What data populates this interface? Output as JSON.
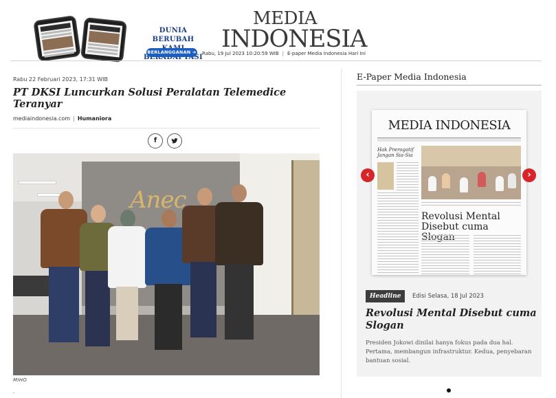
{
  "header": {
    "promo_line1": "DUNIA BERUBAH",
    "promo_line2": "KAMI BERADAPTASI",
    "subscribe_label": "BERLANGGANAN",
    "logo_line1": "MEDIA",
    "logo_line2": "INDONESIA",
    "date_time": "Rabu, 19 Jul 2023 10:20:59 WIB",
    "separator": "|",
    "epaper_link": "E-paper Media Indonesia Hari Ini"
  },
  "article": {
    "date": "Rabu 22 Februari 2023, 17:31 WIB",
    "title": "PT DKSI Luncurkan Solusi Peralatan Telemedice Teranyar",
    "source": "mediaindonesia.com",
    "source_separator": "|",
    "category": "Humaniora",
    "share_facebook": "f",
    "share_twitter": "🐦",
    "photo_sign": "Anec",
    "photo_credit": "MIHO",
    "trailing_text": "."
  },
  "sidebar": {
    "title": "E-Paper Media Indonesia",
    "epaper_logo": "MEDIA INDONESIA",
    "epaper_small_head": "Hak Prerogatif Jangan Sia-Sia",
    "epaper_headline": "Revolusi Mental Disebut cuma Slogan",
    "prev_arrow": "‹",
    "next_arrow": "›",
    "badge": "Headline",
    "edition": "Edisi Selasa, 18 Jul 2023",
    "headline": "Revolusi Mental Disebut cuma Slogan",
    "summary": "Presiden Jokowi dinilai hanya fokus pada dua hal. Pertama, membangun infrastruktur. Kedua, penyebaran bantuan sosial."
  },
  "colors": {
    "accent_red": "#d6262b",
    "brand_blue": "#1b3f86",
    "button_blue": "#1d5fc1",
    "badge_dark": "#3d3d3d"
  },
  "icons": {
    "share_facebook": "facebook-icon",
    "share_twitter": "twitter-icon",
    "prev": "chevron-left-icon",
    "next": "chevron-right-icon"
  }
}
